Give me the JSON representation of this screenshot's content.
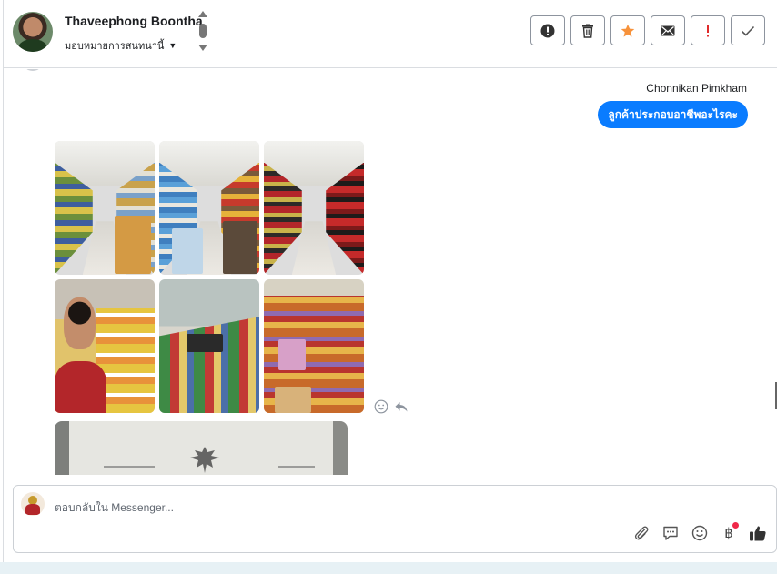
{
  "header": {
    "contact_name": "Thaveephong Boontha",
    "assign_label": "มอบหมายการสนทนานี้",
    "actions": [
      {
        "name": "spam",
        "icon": "alert-circle-icon"
      },
      {
        "name": "delete",
        "icon": "trash-icon"
      },
      {
        "name": "star",
        "icon": "star-icon",
        "color": "#f7923b"
      },
      {
        "name": "mark-unread",
        "icon": "envelope-icon"
      },
      {
        "name": "follow-up",
        "icon": "exclamation-icon",
        "color": "#e02b2b"
      },
      {
        "name": "mark-done",
        "icon": "check-icon"
      }
    ]
  },
  "thread": {
    "outgoing_sender": "Chonnikan Pimkham",
    "outgoing_message": "ลูกค้าประกอบอาชีพอะไรคะ",
    "accent_color": "#0a7cff"
  },
  "composer": {
    "placeholder": "ตอบกลับใน Messenger..."
  }
}
